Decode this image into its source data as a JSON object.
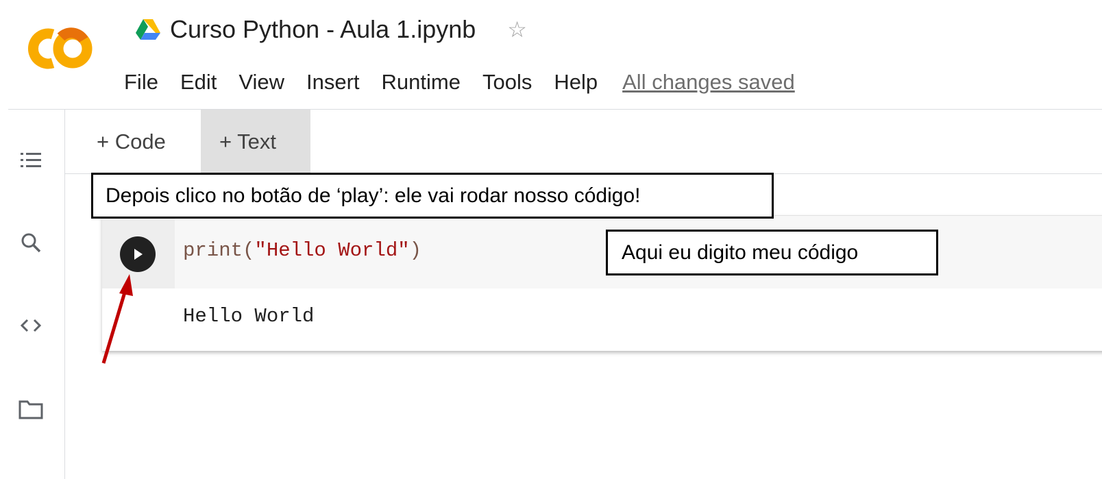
{
  "header": {
    "logo_text": "CO",
    "title": "Curso Python - Aula 1.ipynb",
    "drive_icon": "google-drive-icon",
    "star_icon": "star-outline-icon"
  },
  "menu": {
    "items": [
      "File",
      "Edit",
      "View",
      "Insert",
      "Runtime",
      "Tools",
      "Help"
    ],
    "status": "All changes saved"
  },
  "sidebar": {
    "icons": [
      "table-of-contents-icon",
      "search-icon",
      "code-snippets-icon",
      "folder-icon"
    ]
  },
  "toolbar": {
    "add_code": "+ Code",
    "add_text": "+ Text"
  },
  "cell": {
    "code_fn": "print(",
    "code_str": "\"Hello World\"",
    "code_close": ")",
    "output": "Hello World"
  },
  "annotations": {
    "play_callout": "Depois clico no botão de ‘play’: ele vai rodar nosso código!",
    "code_callout": "Aqui eu digito meu código",
    "arrow_color": "#c00000"
  },
  "colors": {
    "logo_orange": "#f9ab00",
    "logo_yellow": "#e8710a"
  }
}
